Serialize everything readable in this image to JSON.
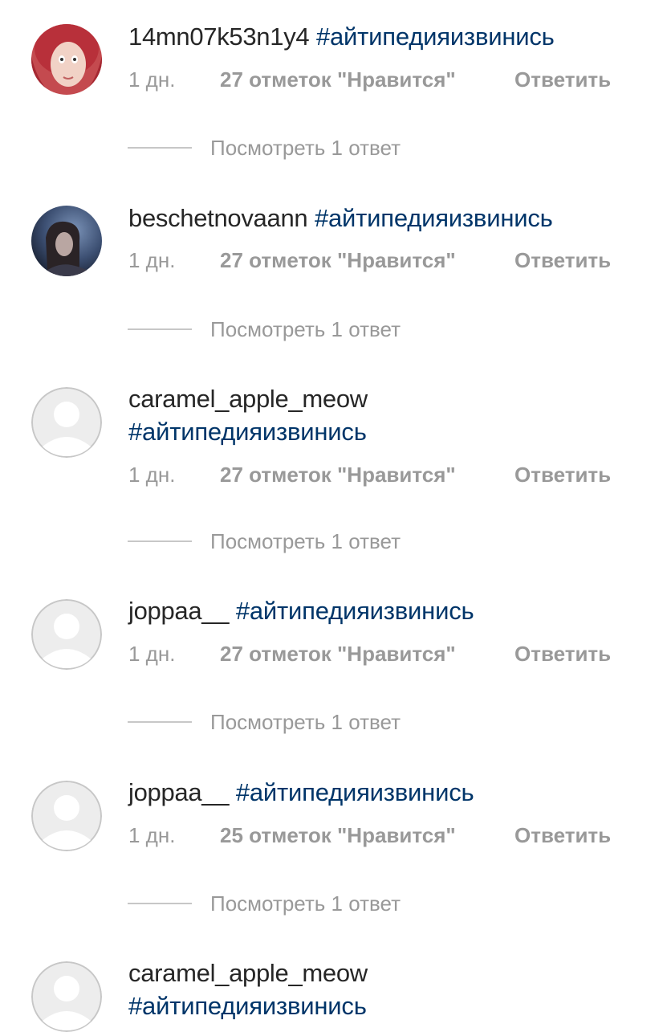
{
  "comments": [
    {
      "username": "14mn07k53n1y4",
      "hashtag": "#айтипедияизвинись",
      "time": "1 дн.",
      "likes": "27 отметок \"Нравится\"",
      "reply": "Ответить",
      "view_replies": "Посмотреть 1 ответ",
      "avatar": "photo-red-hair"
    },
    {
      "username": "beschetnovaann",
      "hashtag": "#айтипедияизвинись",
      "time": "1 дн.",
      "likes": "27 отметок \"Нравится\"",
      "reply": "Ответить",
      "view_replies": "Посмотреть 1 ответ",
      "avatar": "photo-dark"
    },
    {
      "username": "caramel_apple_meow",
      "hashtag": "#айтипедияизвинись",
      "time": "1 дн.",
      "likes": "27 отметок \"Нравится\"",
      "reply": "Ответить",
      "view_replies": "Посмотреть 1 ответ",
      "avatar": "default-avatar"
    },
    {
      "username": "joppaa__",
      "hashtag": "#айтипедияизвинись",
      "time": "1 дн.",
      "likes": "27 отметок \"Нравится\"",
      "reply": "Ответить",
      "view_replies": "Посмотреть 1 ответ",
      "avatar": "default-avatar"
    },
    {
      "username": "joppaa__",
      "hashtag": "#айтипедияизвинись",
      "time": "1 дн.",
      "likes": "25 отметок \"Нравится\"",
      "reply": "Ответить",
      "view_replies": "Посмотреть 1 ответ",
      "avatar": "default-avatar"
    },
    {
      "username": "caramel_apple_meow",
      "hashtag": "#айтипедияизвинись",
      "avatar": "default-avatar"
    }
  ],
  "colors": {
    "username": "#262626",
    "hashtag": "#003569",
    "meta": "#999999",
    "divider": "#c7c7c7",
    "default_avatar_bg": "#ededed"
  }
}
